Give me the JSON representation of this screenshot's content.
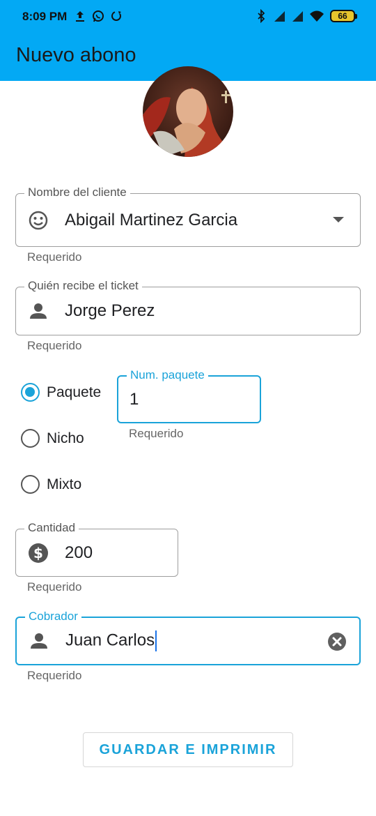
{
  "status_bar": {
    "time": "8:09 PM",
    "battery": "66",
    "icons": [
      "upload-icon",
      "whatsapp-icon",
      "sync-icon",
      "bluetooth-icon",
      "signal-icon",
      "signal-icon",
      "wifi-icon",
      "battery-icon"
    ]
  },
  "app_bar": {
    "title": "Nuevo abono"
  },
  "form": {
    "cliente": {
      "label": "Nombre del cliente",
      "value": "Abigail Martinez Garcia",
      "helper": "Requerido"
    },
    "recibe": {
      "label": "Quién recibe el ticket",
      "value": "Jorge Perez",
      "helper": "Requerido"
    },
    "tipo": {
      "options": [
        "Paquete",
        "Nicho",
        "Mixto"
      ],
      "selected": "Paquete"
    },
    "num_paquete": {
      "label": "Num. paquete",
      "value": "1",
      "helper": "Requerido"
    },
    "cantidad": {
      "label": "Cantidad",
      "value": "200",
      "helper": "Requerido"
    },
    "cobrador": {
      "label": "Cobrador",
      "value": "Juan Carlos",
      "helper": "Requerido"
    }
  },
  "actions": {
    "save_label": "GUARDAR E IMPRIMIR"
  },
  "colors": {
    "primary": "#03a9f4",
    "accent": "#1aa3d9"
  }
}
